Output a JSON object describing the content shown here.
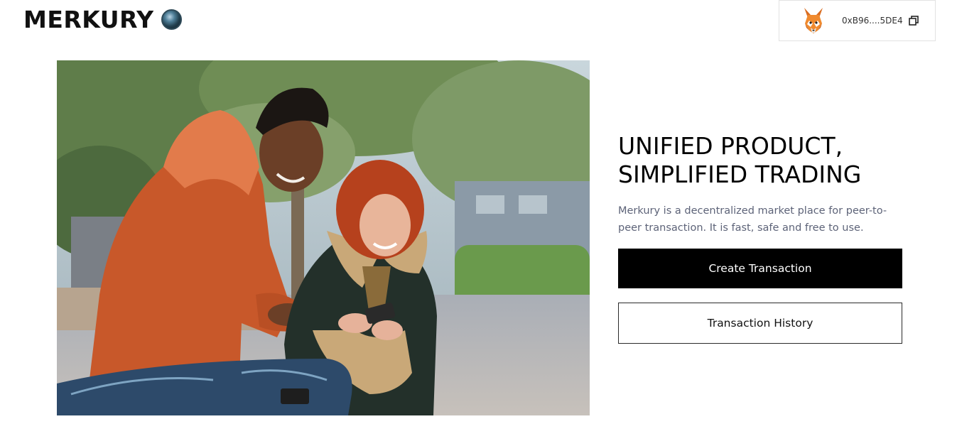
{
  "header": {
    "logo_text": "MERKURY",
    "logo_icon": "globe-icon"
  },
  "wallet": {
    "avatar_icon": "metamask-fox-icon",
    "address": "0xB96....5DE4",
    "copy_icon": "copy-icon"
  },
  "hero": {
    "image_alt": "Young man in orange hoodie holding skateboard and smiling woman with red curly hair looking at a phone outdoors",
    "headline_line1": "UNIFIED PRODUCT,",
    "headline_line2": "SIMPLIFIED TRADING",
    "description": "Merkury is a decentralized market place for peer-to-peer transaction. It is fast, safe and free to use.",
    "primary_button": "Create Transaction",
    "secondary_button": "Transaction History"
  },
  "colors": {
    "primary_button_bg": "#000000",
    "description_text": "#5d6378"
  }
}
